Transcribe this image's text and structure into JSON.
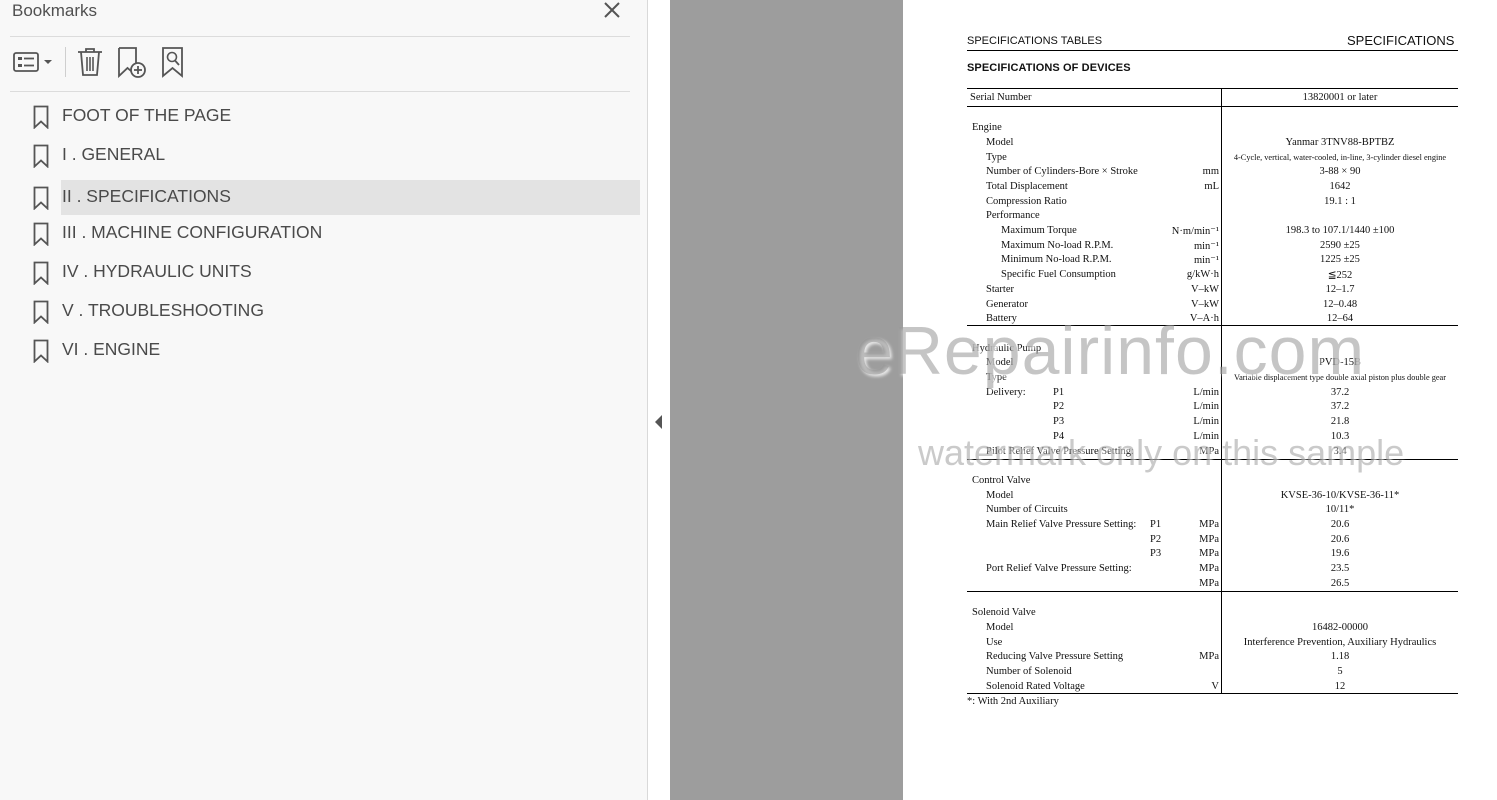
{
  "bookmarks_panel": {
    "title": "Bookmarks",
    "close_icon": "close-icon",
    "toolbar": {
      "options_icon": "list-options-icon",
      "delete_icon": "trash-icon",
      "add_icon": "add-bookmark-icon",
      "search_icon": "find-bookmark-icon"
    },
    "items": [
      {
        "label": "FOOT OF THE PAGE",
        "selected": false
      },
      {
        "label": "I . GENERAL",
        "selected": false
      },
      {
        "label": "II . SPECIFICATIONS",
        "selected": true
      },
      {
        "label": "III . MACHINE CONFIGURATION",
        "selected": false
      },
      {
        "label": "IV . HYDRAULIC UNITS",
        "selected": false
      },
      {
        "label": "V . TROUBLESHOOTING",
        "selected": false
      },
      {
        "label": "VI . ENGINE",
        "selected": false
      }
    ]
  },
  "document": {
    "header_left": "SPECIFICATIONS TABLES",
    "header_right": "SPECIFICATIONS",
    "subheading": "SPECIFICATIONS OF DEVICES",
    "rows": [
      {
        "c1": "Serial Number",
        "c2": "",
        "c3": "13820001 or later"
      },
      {
        "c1": "Engine",
        "c2": "",
        "c3": ""
      },
      {
        "c1": "Model",
        "c2": "",
        "c3": "Yanmar 3TNV88-BPTBZ"
      },
      {
        "c1": "Type",
        "c2": "",
        "c3": "4-Cycle, vertical, water-cooled, in-line, 3-cylinder diesel engine"
      },
      {
        "c1": "Number of Cylinders-Bore × Stroke",
        "c2": "mm",
        "c3": "3-88 × 90"
      },
      {
        "c1": "Total Displacement",
        "c2": "mL",
        "c3": "1642"
      },
      {
        "c1": "Compression Ratio",
        "c2": "",
        "c3": "19.1 : 1"
      },
      {
        "c1": "Performance",
        "c2": "",
        "c3": ""
      },
      {
        "c1": "Maximum Torque",
        "c2": "N·m/min⁻¹",
        "c3": "198.3 to 107.1/1440 ±100"
      },
      {
        "c1": "Maximum No-load R.P.M.",
        "c2": "min⁻¹",
        "c3": "2590 ±25"
      },
      {
        "c1": "Minimum No-load R.P.M.",
        "c2": "min⁻¹",
        "c3": "1225 ±25"
      },
      {
        "c1": "Specific Fuel Consumption",
        "c2": "g/kW·h",
        "c3": "≦252"
      },
      {
        "c1": "Starter",
        "c2": "V–kW",
        "c3": "12–1.7"
      },
      {
        "c1": "Generator",
        "c2": "V–kW",
        "c3": "12–0.48"
      },
      {
        "c1": "Battery",
        "c2": "V–A·h",
        "c3": "12–64"
      },
      {
        "c1": "Hydraulic Pump",
        "c2": "",
        "c3": ""
      },
      {
        "c1": "Model",
        "c2": "",
        "c3": "PVD-15B"
      },
      {
        "c1": "Type",
        "c2": "",
        "c3": "Variable displacement type double axial piston plus double gear"
      },
      {
        "c1": "Delivery:",
        "c1b": "P1",
        "c2": "L/min",
        "c3": "37.2"
      },
      {
        "c1": "",
        "c1b": "P2",
        "c2": "L/min",
        "c3": "37.2"
      },
      {
        "c1": "",
        "c1b": "P3",
        "c2": "L/min",
        "c3": "21.8"
      },
      {
        "c1": "",
        "c1b": "P4",
        "c2": "L/min",
        "c3": "10.3"
      },
      {
        "c1": "Pilot Relief Valve Pressure Setting:",
        "c2": "MPa",
        "c3": "3.4"
      },
      {
        "c1": "Control Valve",
        "c2": "",
        "c3": ""
      },
      {
        "c1": "Model",
        "c2": "",
        "c3": "KVSE-36-10/KVSE-36-11*"
      },
      {
        "c1": "Number of Circuits",
        "c2": "",
        "c3": "10/11*"
      },
      {
        "c1": "Main Relief Valve Pressure Setting:",
        "c1b": "P1",
        "c2": "MPa",
        "c3": "20.6"
      },
      {
        "c1": "",
        "c1b": "P2",
        "c2": "MPa",
        "c3": "20.6"
      },
      {
        "c1": "",
        "c1b": "P3",
        "c2": "MPa",
        "c3": "19.6"
      },
      {
        "c1": "Port Relief Valve Pressure Setting:",
        "c2": "MPa",
        "c3": "23.5"
      },
      {
        "c1": "",
        "c2": "MPa",
        "c3": "26.5"
      },
      {
        "c1": "Solenoid Valve",
        "c2": "",
        "c3": ""
      },
      {
        "c1": "Model",
        "c2": "",
        "c3": "16482-00000"
      },
      {
        "c1": "Use",
        "c2": "",
        "c3": "Interference Prevention, Auxiliary Hydraulics"
      },
      {
        "c1": "Reducing Valve Pressure Setting",
        "c2": "MPa",
        "c3": "1.18"
      },
      {
        "c1": "Number of Solenoid",
        "c2": "",
        "c3": "5"
      },
      {
        "c1": "Solenoid Rated Voltage",
        "c2": "V",
        "c3": "12"
      }
    ],
    "footnote": "*: With 2nd Auxiliary",
    "watermark_line1": "eRepairinfo.com",
    "watermark_line2": "watermark only on this sample"
  }
}
